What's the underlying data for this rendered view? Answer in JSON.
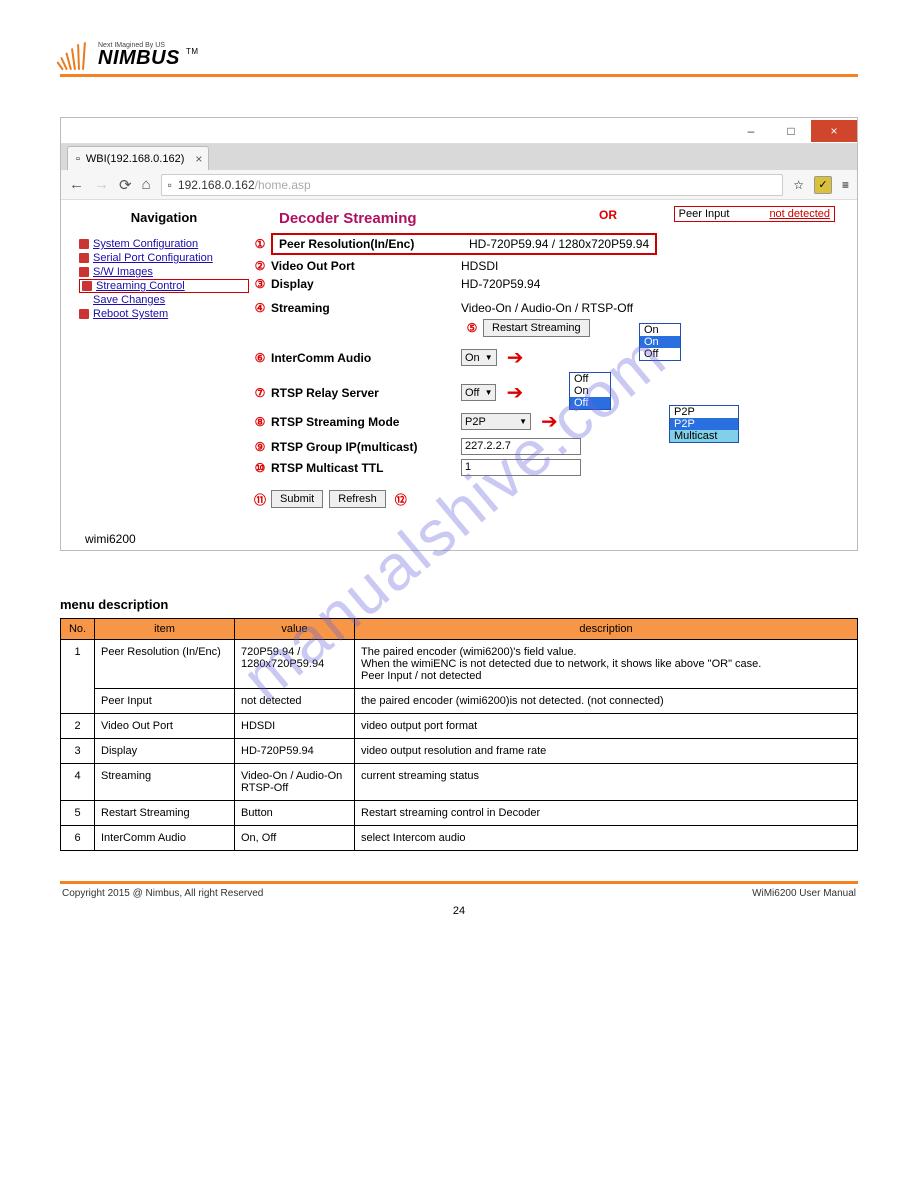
{
  "logo": {
    "tagline": "Next IMagined By US",
    "name": "NIMBUS",
    "tm": "TM"
  },
  "watermark": "manualshive.com",
  "window": {
    "tab_title": "WBI(192.168.0.162)",
    "url_host": "192.168.0.162",
    "url_path": "/home.asp",
    "minimize": "–",
    "maximize": "□",
    "close": "×"
  },
  "nav": {
    "title": "Navigation",
    "items": [
      "System Configuration",
      "Serial Port Configuration",
      "S/W Images",
      "Streaming Control",
      "Save Changes",
      "Reboot System"
    ],
    "model": "wimi6200"
  },
  "content": {
    "heading": "Decoder Streaming",
    "or_label": "OR",
    "peer_input_label": "Peer Input",
    "peer_input_value": "not detected",
    "rows": {
      "r1": {
        "num": "①",
        "label": "Peer Resolution(In/Enc)",
        "value": "HD-720P59.94 / 1280x720P59.94"
      },
      "r2": {
        "num": "②",
        "label": "Video Out Port",
        "value": "HDSDI"
      },
      "r3": {
        "num": "③",
        "label": "Display",
        "value": "HD-720P59.94"
      },
      "r4": {
        "num": "④",
        "label": "Streaming",
        "value": "Video-On / Audio-On / RTSP-Off"
      },
      "r5": {
        "num": "⑤",
        "label": "",
        "button": "Restart Streaming"
      },
      "r6": {
        "num": "⑥",
        "label": "InterComm Audio",
        "select": "On",
        "opts": [
          "On",
          "On",
          "Off"
        ]
      },
      "r7": {
        "num": "⑦",
        "label": "RTSP Relay Server",
        "select": "Off",
        "opts": [
          "Off",
          "On",
          "Off"
        ]
      },
      "r8": {
        "num": "⑧",
        "label": "RTSP Streaming Mode",
        "select": "P2P",
        "opts": [
          "P2P",
          "P2P",
          "Multicast"
        ]
      },
      "r9": {
        "num": "⑨",
        "label": "RTSP Group IP(multicast)",
        "input": "227.2.2.7"
      },
      "r10": {
        "num": "⑩",
        "label": "RTSP Multicast TTL",
        "input": "1"
      },
      "r11": {
        "num": "⑪",
        "button": "Submit"
      },
      "r12": {
        "num": "⑫",
        "button": "Refresh"
      }
    }
  },
  "section_title": "menu description",
  "table": {
    "head": [
      "No.",
      "item",
      "value",
      "description"
    ],
    "rows": [
      {
        "n": "1",
        "item": "Peer Resolution (In/Enc)",
        "val": "720P59.94 / 1280x720P59.94",
        "desc": "The paired encoder (wimi6200)'s field value.\nWhen the wimiENC is not detected due to network, it shows like above \"OR\" case.\nPeer Input / not detected"
      },
      {
        "n": "",
        "item": "Peer Input",
        "val": "not detected",
        "desc": "the paired encoder (wimi6200)is not detected. (not connected)"
      },
      {
        "n": "2",
        "item": "Video Out Port",
        "val": "HDSDI",
        "desc": "video output port format"
      },
      {
        "n": "3",
        "item": "Display",
        "val": "HD-720P59.94",
        "desc": "video output resolution and frame rate"
      },
      {
        "n": "4",
        "item": "Streaming",
        "val": "Video-On / Audio-On\nRTSP-Off",
        "desc": "current streaming status"
      },
      {
        "n": "5",
        "item": "Restart Streaming",
        "val": "Button",
        "desc": "Restart streaming control in Decoder"
      },
      {
        "n": "6",
        "item": "InterComm Audio",
        "val": "On, Off",
        "desc": "select Intercom audio"
      }
    ]
  },
  "footer": {
    "left": "Copyright 2015 @ Nimbus, All right Reserved",
    "right": "WiMi6200 User Manual",
    "page": "24"
  }
}
